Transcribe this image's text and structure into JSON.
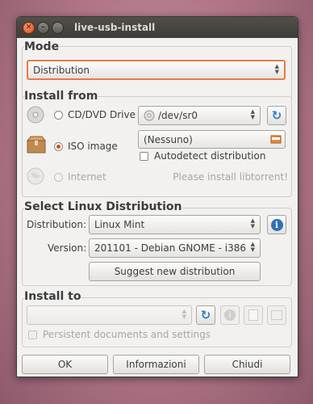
{
  "window": {
    "title": "live-usb-install"
  },
  "mode": {
    "title": "Mode",
    "selected": "Distribution"
  },
  "install_from": {
    "title": "Install from",
    "cd_label": "CD/DVD Drive",
    "cd_device": "/dev/sr0",
    "iso_label": "ISO image",
    "iso_file": "(Nessuno)",
    "autodetect_label": "Autodetect distribution",
    "internet_label": "Internet",
    "libtorrent_msg": "Please install libtorrent!"
  },
  "distro": {
    "title": "Select Linux Distribution",
    "distribution_label": "Distribution:",
    "distribution_value": "Linux Mint",
    "version_label": "Version:",
    "version_value": "201101 - Debian GNOME - i386",
    "suggest_label": "Suggest new distribution"
  },
  "install_to": {
    "title": "Install to",
    "device_value": "",
    "persistent_label": "Persistent documents and settings"
  },
  "buttons": {
    "ok": "OK",
    "info": "Informazioni",
    "close": "Chiudi"
  },
  "colors": {
    "accent": "#e67b48",
    "refresh_blue": "#2f7fc8",
    "radio_orange": "#d44e1c"
  }
}
